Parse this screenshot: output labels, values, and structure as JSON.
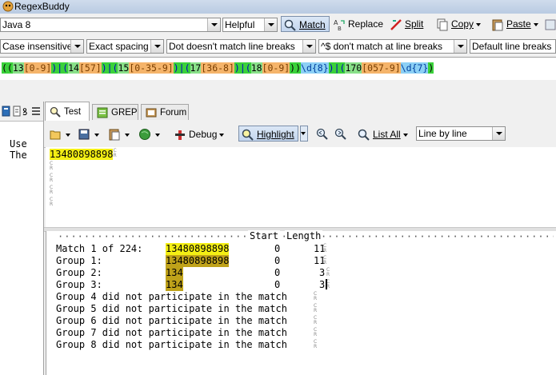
{
  "window": {
    "title": "RegexBuddy",
    "path": ""
  },
  "toolbar1": {
    "flavor": "Java 8",
    "helpful": "Helpful",
    "match": "Match",
    "replace": "Replace",
    "split": "Split",
    "copy": "Copy",
    "paste": "Paste"
  },
  "options": {
    "case": "Case insensitive",
    "spacing": "Exact spacing",
    "dot": "Dot doesn't match line breaks",
    "anchors": "^$ don't match at line breaks",
    "linebreaks": "Default line breaks"
  },
  "regex": {
    "parts": [
      "((",
      "13",
      "[0-9]",
      ")|(",
      "14",
      "[57]",
      ")|(",
      "15",
      "[0-35-9]",
      ")|(",
      "17",
      "[36-8]",
      ")|(",
      "18",
      "[0-9]",
      "))",
      "\\d{8}",
      ")|(",
      "170",
      "[057-9]",
      "\\d{7}",
      ")"
    ]
  },
  "tabs": {
    "test": "Test",
    "grep": "GREP",
    "forum": "Forum"
  },
  "left_lines": [
    "Use",
    "The"
  ],
  "test_toolbar": {
    "debug": "Debug",
    "highlight": "Highlight",
    "list_all": "List All",
    "mode": "Line by line"
  },
  "subject": {
    "first": "13480898898",
    "crlf": [
      "C",
      "L"
    ],
    "crlf2": [
      "R",
      "F"
    ]
  },
  "results": {
    "header": {
      "start": "Start",
      "length": "Length"
    },
    "rows": [
      {
        "label": "Match 1 of 224:",
        "value": "13480898898",
        "start": "0",
        "length": "11"
      },
      {
        "label": "Group 1:",
        "value": "13480898898",
        "start": "0",
        "length": "11"
      },
      {
        "label": "Group 2:",
        "value": "134",
        "start": "0",
        "length": "3"
      },
      {
        "label": "Group 3:",
        "value": "134",
        "start": "0",
        "length": "3"
      }
    ],
    "na": [
      "Group 4 did not participate in the match",
      "Group 5 did not participate in the match",
      "Group 6 did not participate in the match",
      "Group 7 did not participate in the match",
      "Group 8 did not participate in the match"
    ]
  },
  "colors": {
    "match_highlight": "#f4ef14",
    "group_highlight": "#bfa21a",
    "titlebar": "#cfdcec"
  }
}
